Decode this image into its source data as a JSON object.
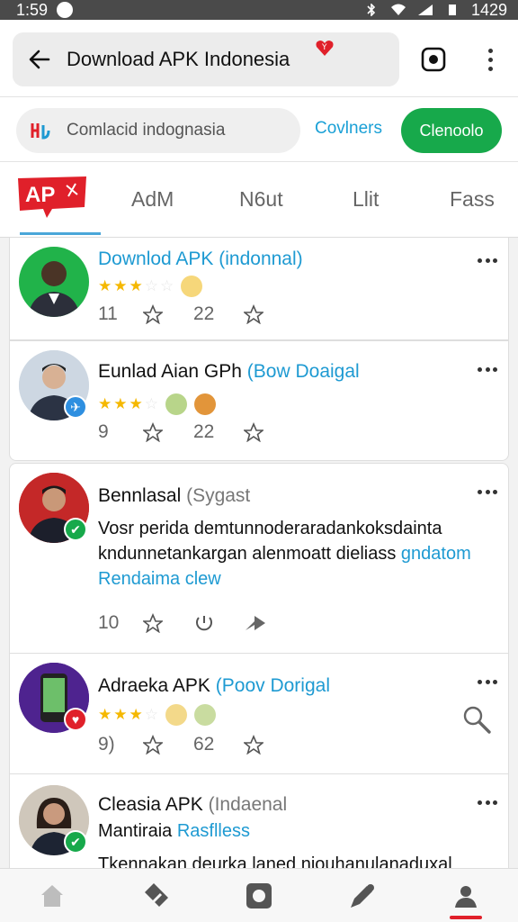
{
  "status_bar": {
    "time": "1:59",
    "right_text": "1429"
  },
  "app_bar": {
    "title": "Download APK Indonesia"
  },
  "filter": {
    "search_placeholder": "Comlacid indognasia",
    "link_label": "Covlners",
    "button_label": "Clenoolo"
  },
  "tabs": {
    "logo_text": "AP",
    "items": [
      "AdM",
      "N6ut",
      "Llit",
      "Fass"
    ]
  },
  "feed": [
    {
      "name": "Downlod APK (indonnal)",
      "name_rest": "",
      "stars": 3,
      "stat1": "11",
      "stat2": "22"
    },
    {
      "name": "Eunlad Aian GPh",
      "name_rest": "(Bow Doaigal",
      "stars": 3,
      "stat1": "9",
      "stat2": "22"
    },
    {
      "name": "Bennlasal",
      "name_rest": "(Sygast",
      "body_line1": "Vosr perida demtunnoderaradankoksdainta",
      "body_line2": "kndunnetankargan alenmoatt dieliass",
      "body_link": "gndatom",
      "body_line3": "Rendaima clew",
      "stat1": "10"
    },
    {
      "name": "Adraeka APK",
      "name_rest": "(Poov Dorigal",
      "stars": 3,
      "stat1": "9)",
      "stat2": "62"
    },
    {
      "name": "Cleasia APK",
      "name_rest": "(Indaenal",
      "sub": "Mantiraia",
      "sub_link": "Rasflless",
      "body_line1": "Tkennakan deurka laned niouhanulanaduxal"
    }
  ],
  "colors": {
    "accent_blue": "#1e9ad2",
    "green": "#17a94b",
    "red": "#e0202a",
    "star": "#f5b800"
  },
  "icons": [
    "back-arrow-icon",
    "camera-icon",
    "more-vert-icon",
    "star-outline-icon",
    "home-icon",
    "tag-icon",
    "profile-icon",
    "search-icon"
  ]
}
